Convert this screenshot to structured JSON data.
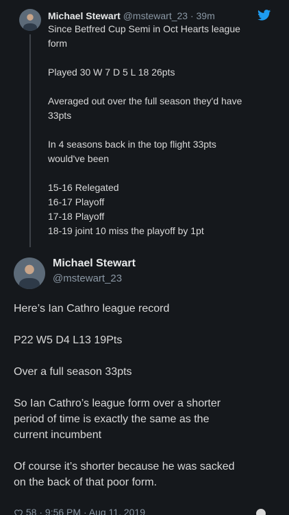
{
  "quoted_tweet": {
    "author_name": "Michael Stewart",
    "handle": "@mstewart_23",
    "time": "· 39m",
    "lines": [
      "Since Betfred Cup Semi in Oct Hearts league",
      "form",
      "",
      "Played 30 W 7 D 5 L 18   26pts",
      "",
      "Averaged out over the full season they'd have",
      "33pts",
      "",
      "In 4 seasons back in the top flight 33pts",
      "would've been",
      "",
      "15-16 Relegated",
      "16-17 Playoff",
      "17-18 Playoff",
      "18-19 joint 10 miss the playoff by 1pt"
    ]
  },
  "main_tweet": {
    "author_name": "Michael Stewart",
    "handle": "@mstewart_23",
    "lines": [
      "Here’s Ian Cathro league record",
      "",
      "P22 W5 D4 L13   19Pts",
      "",
      "Over a full season  33pts",
      "",
      "So Ian Cathro’s league form over a shorter",
      "period of time is exactly the same as the",
      "current incumbent",
      "",
      "Of course it’s shorter because he was sacked",
      "on the back of that poor form."
    ],
    "footer": {
      "likes": "58",
      "time": "9:56 PM",
      "date": "Aug 11, 2019"
    }
  },
  "colors": {
    "background": "#15181c",
    "text": "#d9d9d9",
    "secondary": "#8b98a5",
    "twitter_blue": "#1d9bf0"
  }
}
